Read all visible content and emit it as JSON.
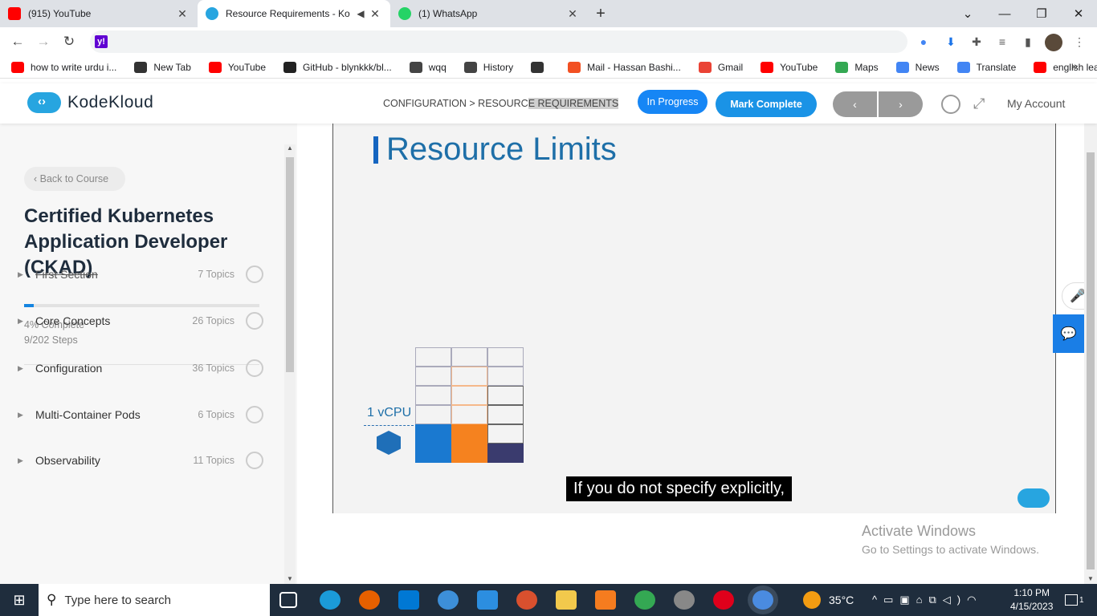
{
  "browser": {
    "tabs": [
      {
        "title": "(915) YouTube",
        "icon": "youtube-icon",
        "active": false
      },
      {
        "title": "Resource Requirements - Ko",
        "icon": "kodekloud-icon",
        "active": true
      },
      {
        "title": "(1) WhatsApp",
        "icon": "whatsapp-icon",
        "active": false
      }
    ],
    "address": "",
    "bookmarks": [
      {
        "label": "how to write urdu i...",
        "icon": "youtube-icon",
        "color": "#ff0000"
      },
      {
        "label": "New Tab",
        "icon": "globe-icon",
        "color": "#333333"
      },
      {
        "label": "YouTube",
        "icon": "youtube-icon",
        "color": "#ff0000"
      },
      {
        "label": "GitHub - blynkkk/bl...",
        "icon": "github-icon",
        "color": "#222222"
      },
      {
        "label": "wqq",
        "icon": "download-icon",
        "color": "#444444"
      },
      {
        "label": "History",
        "icon": "history-icon",
        "color": "#444444"
      },
      {
        "label": "",
        "icon": "globe-icon",
        "color": "#333333"
      },
      {
        "label": "Mail - Hassan Bashi...",
        "icon": "microsoft-icon",
        "color": "#f25022"
      },
      {
        "label": "Gmail",
        "icon": "gmail-icon",
        "color": "#ea4335"
      },
      {
        "label": "YouTube",
        "icon": "youtube-icon",
        "color": "#ff0000"
      },
      {
        "label": "Maps",
        "icon": "maps-icon",
        "color": "#34a853"
      },
      {
        "label": "News",
        "icon": "news-icon",
        "color": "#4285f4"
      },
      {
        "label": "Translate",
        "icon": "translate-icon",
        "color": "#4285f4"
      },
      {
        "label": "english learning",
        "icon": "youtube-icon",
        "color": "#ff0000"
      }
    ]
  },
  "header": {
    "brand": "KodeKloud",
    "breadcrumb_a": "CONFIGURATION > RESOURC",
    "breadcrumb_b": "E REQUIREMENTS",
    "status_label": "In Progress",
    "mark_complete_label": "Mark Complete",
    "prev_label": "‹",
    "next_label": "›",
    "account_label": "My Account"
  },
  "sidebar": {
    "back_label": "‹  Back to Course",
    "course_title": "Certified Kubernetes Application Developer (CKAD)",
    "progress_percent": 4,
    "progress_text": "4% Complete",
    "steps_text": "9/202 Steps",
    "sections": [
      {
        "name": "First Section",
        "topics": "7 Topics",
        "done": true
      },
      {
        "name": "Core Concepts",
        "topics": "26 Topics",
        "done": false
      },
      {
        "name": "Configuration",
        "topics": "36 Topics",
        "done": false
      },
      {
        "name": "Multi-Container Pods",
        "topics": "6 Topics",
        "done": false
      },
      {
        "name": "Observability",
        "topics": "11 Topics",
        "done": false
      }
    ]
  },
  "video": {
    "slide_title": "Resource Limits",
    "vcpu_label": "1 vCPU",
    "caption": "If you do not specify explicitly,"
  },
  "watermark": {
    "line1": "Activate Windows",
    "line2": "Go to Settings to activate Windows."
  },
  "taskbar": {
    "search_placeholder": "Type here to search",
    "weather": "35°C",
    "time": "1:10 PM",
    "date": "4/15/2023",
    "notifications": "1"
  }
}
